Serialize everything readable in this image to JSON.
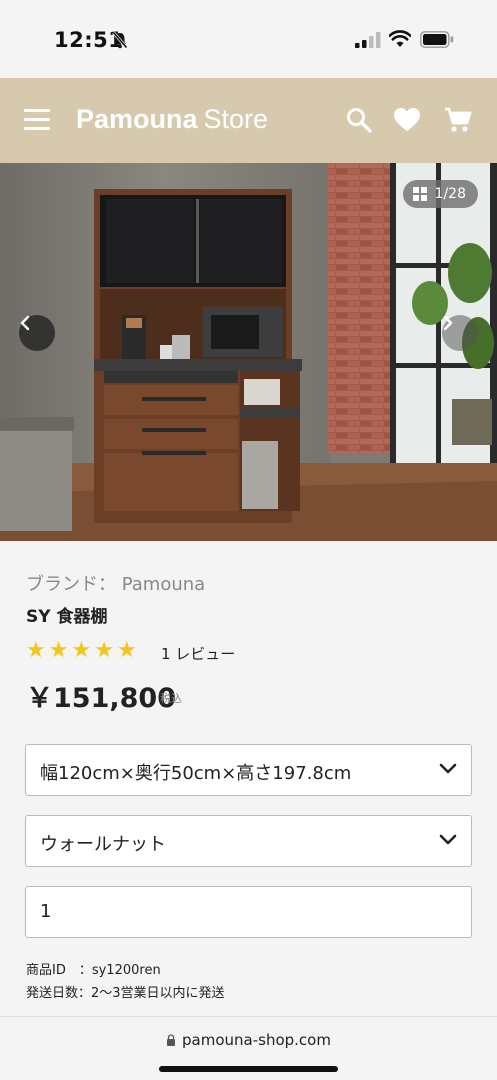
{
  "status_bar": {
    "time": "12:51"
  },
  "header": {
    "logo_brand": "Pamouna",
    "logo_store": "Store"
  },
  "gallery": {
    "counter": "1/28"
  },
  "product": {
    "brand_line": "ブランド： Pamouna",
    "name": "SY 食器棚",
    "rating_stars": 5,
    "review_count": "1 レビュー",
    "price": "￥151,800",
    "tax_label": "税込"
  },
  "options": {
    "size_selected": "幅120cm×奥行50cm×高さ197.8cm",
    "color_selected": "ウォールナット",
    "quantity": "1"
  },
  "meta": {
    "product_id": "商品ID　：sy1200ren",
    "shipping": "発送日数：2〜3営業日以内に発送"
  },
  "browser": {
    "url": "pamouna-shop.com"
  },
  "colors": {
    "header_bg": "#d6c9ad",
    "star": "#f5c518",
    "page_bg": "#f4f4f4"
  }
}
